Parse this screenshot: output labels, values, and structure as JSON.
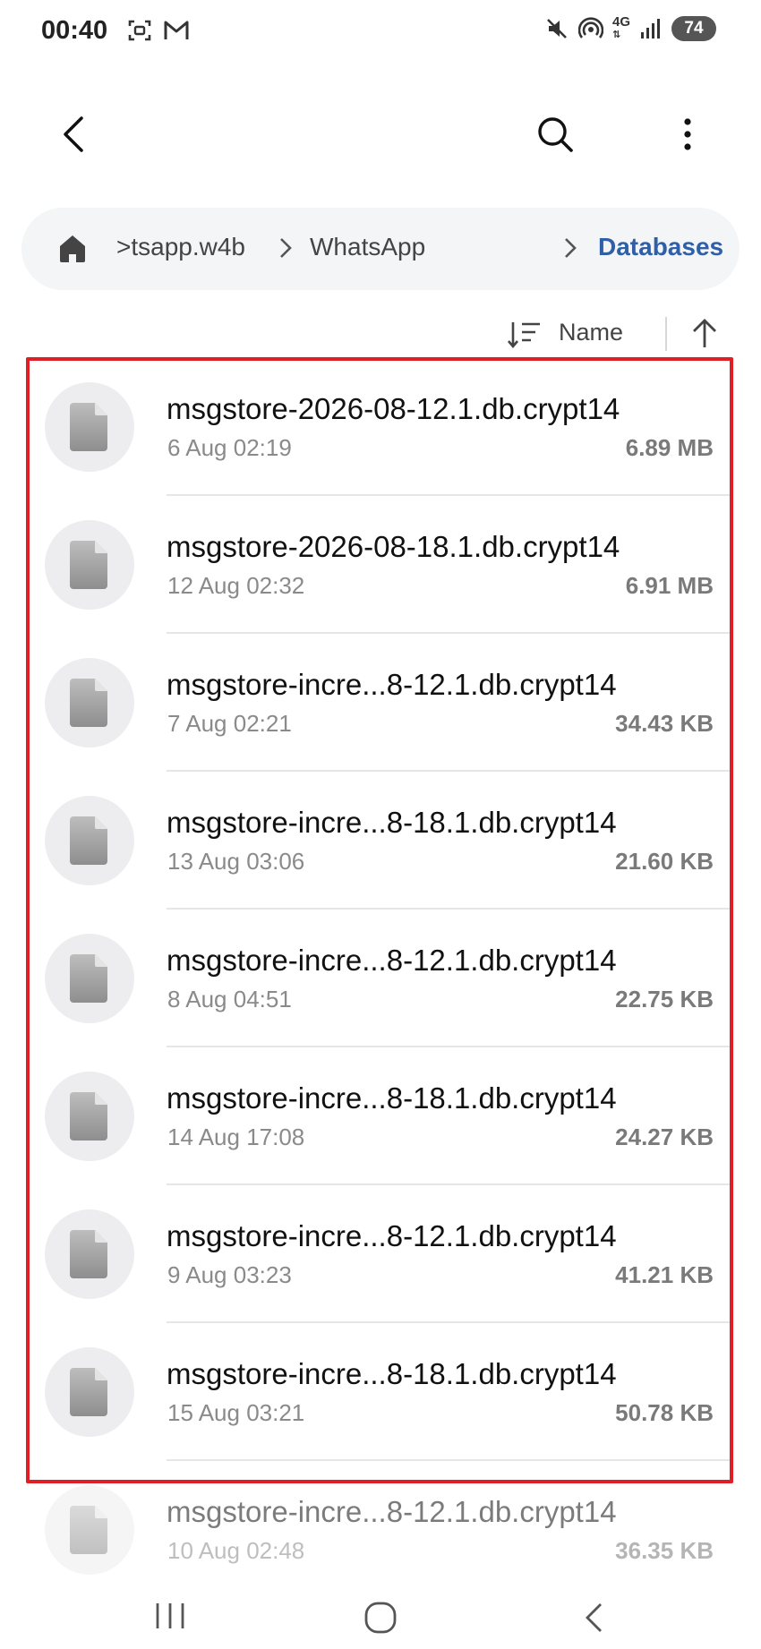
{
  "status_bar": {
    "time": "00:40",
    "network": "4G",
    "battery": "74"
  },
  "app_bar": {
    "back_icon": "back-arrow-icon",
    "search_icon": "search-icon",
    "more_icon": "more-vert-icon"
  },
  "breadcrumb": {
    "items": [
      {
        "label": ">tsapp.w4b"
      },
      {
        "label": "WhatsApp"
      },
      {
        "label": "Databases"
      }
    ],
    "active_color": "#2e5fa8"
  },
  "sort": {
    "label": "Name"
  },
  "files": [
    {
      "name": "msgstore-2026-08-12.1.db.crypt14",
      "date": "6 Aug 02:19",
      "size": "6.89 MB"
    },
    {
      "name": "msgstore-2026-08-18.1.db.crypt14",
      "date": "12 Aug 02:32",
      "size": "6.91 MB"
    },
    {
      "name": "msgstore-incre...8-12.1.db.crypt14",
      "date": "7 Aug 02:21",
      "size": "34.43 KB"
    },
    {
      "name": "msgstore-incre...8-18.1.db.crypt14",
      "date": "13 Aug 03:06",
      "size": "21.60 KB"
    },
    {
      "name": "msgstore-incre...8-12.1.db.crypt14",
      "date": "8 Aug 04:51",
      "size": "22.75 KB"
    },
    {
      "name": "msgstore-incre...8-18.1.db.crypt14",
      "date": "14 Aug 17:08",
      "size": "24.27 KB"
    },
    {
      "name": "msgstore-incre...8-12.1.db.crypt14",
      "date": "9 Aug 03:23",
      "size": "41.21 KB"
    },
    {
      "name": "msgstore-incre...8-18.1.db.crypt14",
      "date": "15 Aug 03:21",
      "size": "50.78 KB"
    },
    {
      "name": "msgstore-incre...8-12.1.db.crypt14",
      "date": "10 Aug 02:48",
      "size": "36.35 KB"
    }
  ],
  "highlight_color": "#e01e26"
}
